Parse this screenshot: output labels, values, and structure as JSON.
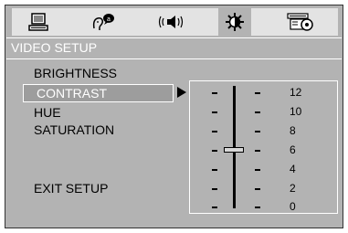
{
  "tabs": [
    {
      "icon": "monitor-icon",
      "active": false
    },
    {
      "icon": "language-icon",
      "active": false
    },
    {
      "icon": "audio-icon",
      "active": false
    },
    {
      "icon": "video-brightness-icon",
      "active": true
    },
    {
      "icon": "preferences-icon",
      "active": false
    }
  ],
  "menu": {
    "title": "VIDEO SETUP",
    "items": [
      "BRIGHTNESS",
      "CONTRAST",
      "HUE",
      "SATURATION"
    ],
    "selected": "CONTRAST",
    "exit": "EXIT SETUP"
  },
  "slider": {
    "labels": [
      "12",
      "10",
      "8",
      "6",
      "4",
      "2",
      "0"
    ],
    "value": 6,
    "max": 12
  },
  "colors": {
    "background": "#b3b3b3",
    "tabbar": "#e3e3e3",
    "highlight": "#9d9d9d"
  }
}
